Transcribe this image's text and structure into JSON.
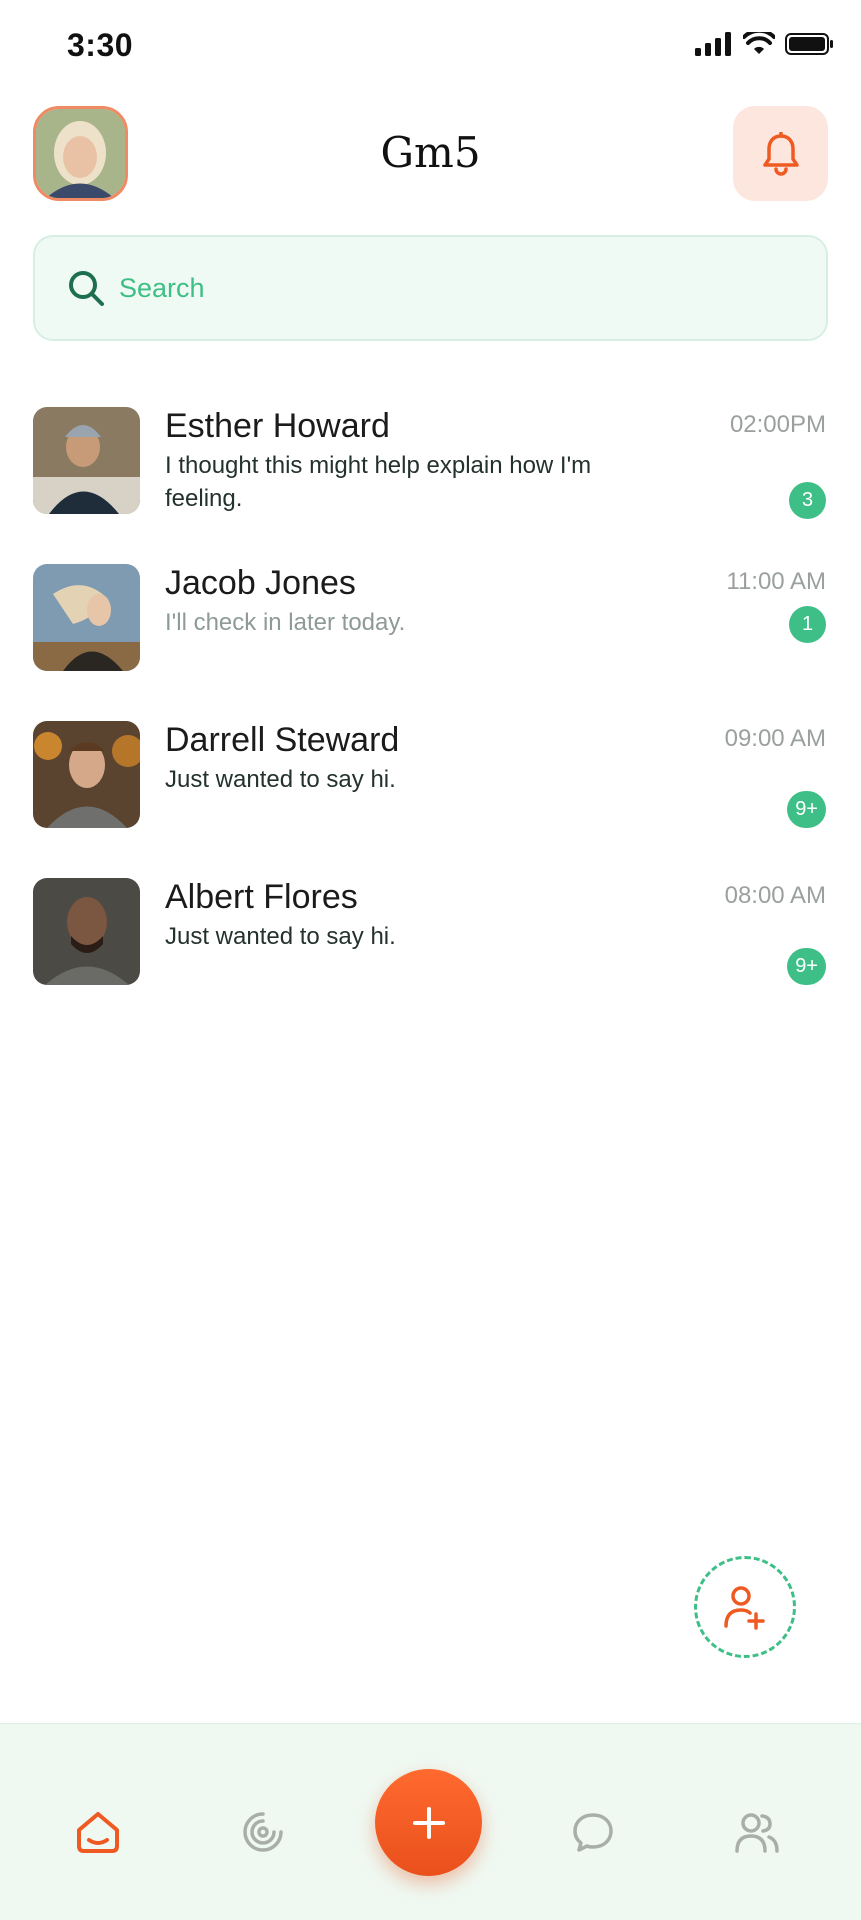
{
  "status_bar": {
    "time": "3:30"
  },
  "header": {
    "title": "Gm5"
  },
  "search": {
    "placeholder": "Search"
  },
  "chats": [
    {
      "name": "Esther Howard",
      "message": "I thought this might help explain how I'm feeling.",
      "time": "02:00PM",
      "unread": "3",
      "message_style": "normal"
    },
    {
      "name": "Jacob Jones",
      "message": "I'll check in later today.",
      "time": "11:00 AM",
      "unread": "1",
      "message_style": "muted"
    },
    {
      "name": "Darrell Steward",
      "message": "Just wanted to say hi.",
      "time": "09:00 AM",
      "unread": "9+",
      "message_style": "normal"
    },
    {
      "name": "Albert Flores",
      "message": "Just wanted to say hi.",
      "time": "08:00 AM",
      "unread": "9+",
      "message_style": "normal"
    }
  ],
  "bottom_nav": {
    "items": [
      {
        "icon": "home-icon",
        "active": true
      },
      {
        "icon": "activity-icon",
        "active": false
      },
      {
        "icon": "plus-icon",
        "active": false
      },
      {
        "icon": "chat-icon",
        "active": false
      },
      {
        "icon": "users-icon",
        "active": false
      }
    ]
  },
  "colors": {
    "accent": "#ef5a22",
    "green": "#3fbf88",
    "search_bg": "#f0faf5",
    "nav_bg": "#eff9f2",
    "bell_bg": "#fde6dd"
  }
}
